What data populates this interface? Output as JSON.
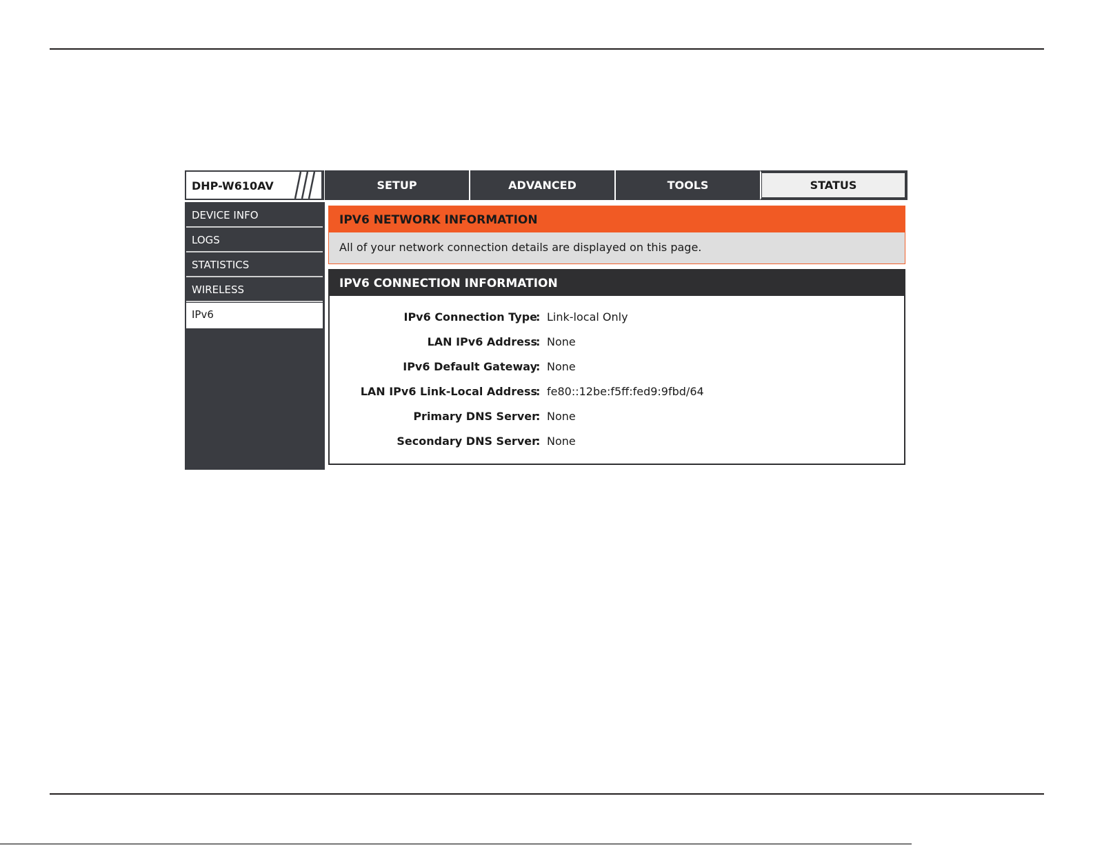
{
  "device": {
    "model": "DHP-W610AV"
  },
  "tabs": [
    {
      "label": "SETUP"
    },
    {
      "label": "ADVANCED"
    },
    {
      "label": "TOOLS"
    },
    {
      "label": "STATUS"
    }
  ],
  "sidebar": {
    "items": [
      {
        "label": "DEVICE INFO"
      },
      {
        "label": "LOGS"
      },
      {
        "label": "STATISTICS"
      },
      {
        "label": "WIRELESS"
      },
      {
        "label": "IPv6"
      }
    ]
  },
  "network_info": {
    "title": "IPV6 NETWORK INFORMATION",
    "description": "All of your network connection details are displayed on this page."
  },
  "connection_info": {
    "title": "IPV6 CONNECTION INFORMATION",
    "colon": ":",
    "rows": [
      {
        "label": "IPv6 Connection Type",
        "value": "Link-local Only"
      },
      {
        "label": "LAN IPv6 Address",
        "value": "None"
      },
      {
        "label": "IPv6 Default Gateway",
        "value": "None"
      },
      {
        "label": "LAN IPv6 Link-Local Address",
        "value": "fe80::12be:f5ff:fed9:9fbd/64"
      },
      {
        "label": "Primary DNS Server",
        "value": "None"
      },
      {
        "label": "Secondary DNS Server",
        "value": "None"
      }
    ]
  },
  "colors": {
    "nav_dark": "#3a3c41",
    "orange_header": "#f15a24",
    "dark_header": "#2f2f31",
    "info_bg": "#dedede"
  }
}
